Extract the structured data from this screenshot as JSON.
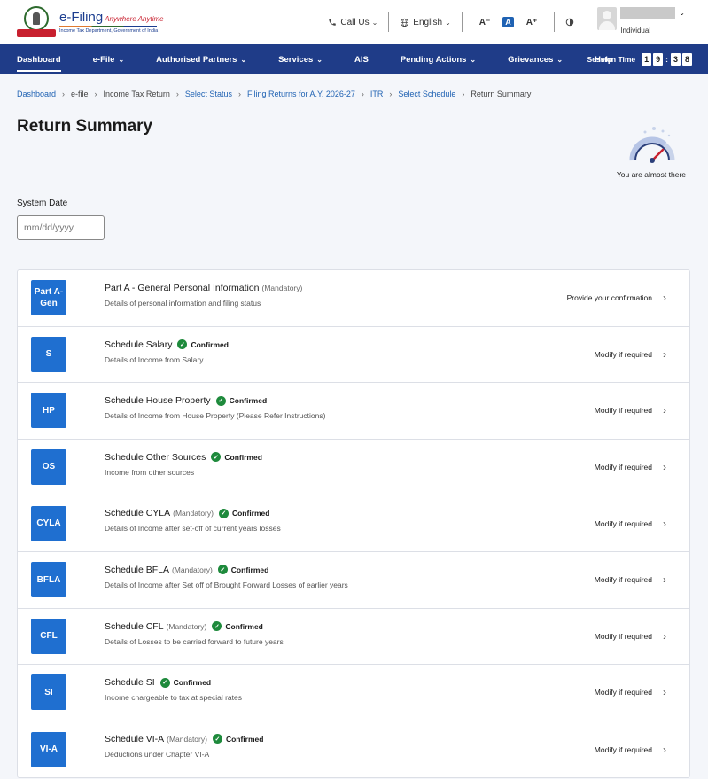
{
  "logo": {
    "title": "e-Filing",
    "tagline": "Anywhere Anytime",
    "subtitle": "Income Tax Department, Government of India"
  },
  "header": {
    "call_us": "Call Us",
    "language": "English",
    "font_decrease": "A⁻",
    "font_default": "A",
    "font_increase": "A⁺",
    "user_role": "Individual"
  },
  "nav": {
    "items": [
      {
        "label": "Dashboard",
        "dropdown": false
      },
      {
        "label": "e-File",
        "dropdown": true
      },
      {
        "label": "Authorised Partners",
        "dropdown": true
      },
      {
        "label": "Services",
        "dropdown": true
      },
      {
        "label": "AIS",
        "dropdown": false
      },
      {
        "label": "Pending Actions",
        "dropdown": true
      },
      {
        "label": "Grievances",
        "dropdown": true
      },
      {
        "label": "Help",
        "dropdown": false
      }
    ],
    "session_label": "Session Time",
    "session_digits": [
      "1",
      "9",
      "3",
      "8"
    ]
  },
  "breadcrumb": [
    {
      "label": "Dashboard",
      "link": true
    },
    {
      "label": "e-file",
      "link": false
    },
    {
      "label": "Income Tax Return",
      "link": false
    },
    {
      "label": "Select Status",
      "link": true
    },
    {
      "label": "Filing Returns for A.Y. 2026-27",
      "link": true
    },
    {
      "label": "ITR",
      "link": true
    },
    {
      "label": "Select Schedule",
      "link": true
    },
    {
      "label": "Return Summary",
      "link": false
    }
  ],
  "page": {
    "title": "Return Summary",
    "progress_text": "You are almost there",
    "system_date_label": "System Date",
    "date_placeholder": "mm/dd/yyyy"
  },
  "colors": {
    "nav_bg": "#1f3c88",
    "badge_bg": "#1f6fd0",
    "confirmed_green": "#1e8a3c",
    "link": "#1f62b3"
  },
  "schedules": [
    {
      "badge": "Part A-\nGen",
      "title": "Part A - General Personal Information",
      "mandatory": "(Mandatory)",
      "confirmed": "",
      "desc": "Details of personal information and filing status",
      "action": "Provide your confirmation"
    },
    {
      "badge": "S",
      "title": "Schedule Salary",
      "mandatory": "",
      "confirmed": "Confirmed",
      "desc": "Details of Income from Salary",
      "action": "Modify if required"
    },
    {
      "badge": "HP",
      "title": "Schedule House Property",
      "mandatory": "",
      "confirmed": "Confirmed",
      "desc": "Details of Income from House Property (Please Refer Instructions)",
      "action": "Modify if required"
    },
    {
      "badge": "OS",
      "title": "Schedule Other Sources",
      "mandatory": "",
      "confirmed": "Confirmed",
      "desc": "Income from other sources",
      "action": "Modify if required"
    },
    {
      "badge": "CYLA",
      "title": "Schedule CYLA",
      "mandatory": "(Mandatory)",
      "confirmed": "Confirmed",
      "desc": "Details of Income after set-off of current years losses",
      "action": "Modify if required"
    },
    {
      "badge": "BFLA",
      "title": "Schedule BFLA",
      "mandatory": "(Mandatory)",
      "confirmed": "Confirmed",
      "desc": "Details of Income after Set off of Brought Forward Losses of earlier years",
      "action": "Modify if required"
    },
    {
      "badge": "CFL",
      "title": "Schedule CFL",
      "mandatory": "(Mandatory)",
      "confirmed": "Confirmed",
      "desc": "Details of Losses to be carried forward to future years",
      "action": "Modify if required"
    },
    {
      "badge": "SI",
      "title": "Schedule SI",
      "mandatory": "",
      "confirmed": "Confirmed",
      "desc": "Income chargeable to tax at special rates",
      "action": "Modify if required"
    },
    {
      "badge": "VI-A",
      "title": "Schedule VI-A",
      "mandatory": "(Mandatory)",
      "confirmed": "Confirmed",
      "desc": "Deductions under Chapter VI-A",
      "action": "Modify if required"
    }
  ]
}
